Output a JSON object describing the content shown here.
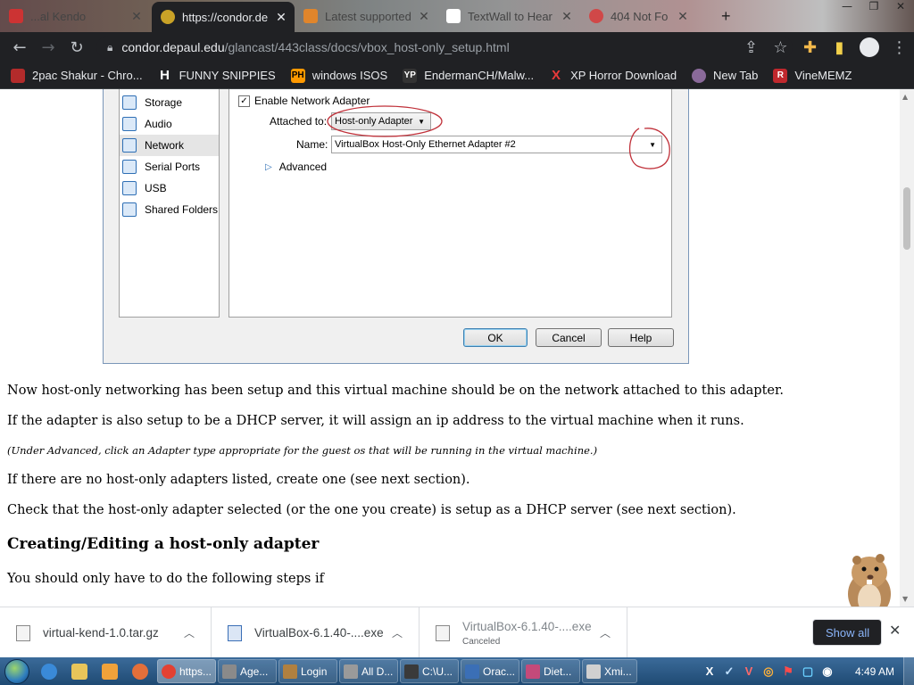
{
  "browser": {
    "tabs": [
      {
        "label": "...al Kendo",
        "icon_color": "#cc3333"
      },
      {
        "label": "https://condor.de",
        "icon_color": "#c9a227"
      },
      {
        "label": "Latest supported",
        "icon_color": "#e0852b"
      },
      {
        "label": "TextWall to Hear",
        "icon_color": "#ffffff"
      },
      {
        "label": "404 Not Fo",
        "icon_color": "#d04848"
      }
    ],
    "window_controls": [
      "—",
      "❐",
      "✕"
    ],
    "url_host": "condor.depaul.edu",
    "url_path": "/glancast/443class/docs/vbox_host-only_setup.html",
    "bookmarks": [
      {
        "label": "2pac Shakur - Chro...",
        "icon": "",
        "icon_color": "#b32b2b"
      },
      {
        "label": "FUNNY SNIPPIES",
        "icon": "H",
        "icon_color": "#202124"
      },
      {
        "label": "windows ISOS",
        "icon": "PH",
        "icon_color": "#ff9900"
      },
      {
        "label": "EndermanCH/Malw...",
        "icon": "YP",
        "icon_color": "#333333"
      },
      {
        "label": "XP Horror Download",
        "icon": "X",
        "icon_color": "#202124"
      },
      {
        "label": "New Tab",
        "icon": "",
        "icon_color": "#8a6a9a"
      },
      {
        "label": "VineMEMZ",
        "icon": "R",
        "icon_color": "#c0282d"
      }
    ]
  },
  "dialog": {
    "categories": [
      {
        "label": "Storage",
        "selected": false
      },
      {
        "label": "Audio",
        "selected": false
      },
      {
        "label": "Network",
        "selected": true
      },
      {
        "label": "Serial Ports",
        "selected": false
      },
      {
        "label": "USB",
        "selected": false
      },
      {
        "label": "Shared Folders",
        "selected": false
      }
    ],
    "enable_label": "Enable Network Adapter",
    "enable_checked": "✓",
    "attached_label": "Attached to:",
    "attached_value": "Host-only Adapter",
    "name_label": "Name:",
    "name_value": "VirtualBox Host-Only Ethernet Adapter #2",
    "advanced_label": "Advanced",
    "ok_label": "OK",
    "cancel_label": "Cancel",
    "help_label": "Help"
  },
  "article": {
    "p1": "Now host-only networking has been setup and this virtual machine should be on the network attached to this adapter.",
    "p2": "If the adapter is also setup to be a DHCP server, it will assign an ip address to the virtual machine when it runs.",
    "note": "(Under Advanced, click an Adapter type appropriate for the guest os that will be running in the virtual machine.)",
    "p3": "If there are no host-only adapters listed, create one (see next section).",
    "p4": "Check that the host-only adapter selected (or the one you create) is setup as a DHCP server (see next section).",
    "heading": "Creating/Editing a host-only adapter",
    "p5": "You should only have to do the following steps if"
  },
  "downloads": {
    "items": [
      {
        "name": "virtual-kend-1.0.tar.gz",
        "sub": ""
      },
      {
        "name": "VirtualBox-6.1.40-....exe",
        "sub": ""
      },
      {
        "name": "VirtualBox-6.1.40-....exe",
        "sub": "Canceled"
      }
    ],
    "show_all": "Show all"
  },
  "taskbar": {
    "items": [
      {
        "label": "https...",
        "color": "#e34133",
        "active": true
      },
      {
        "label": "Age...",
        "color": "#8a8a8a",
        "active": false
      },
      {
        "label": "Login",
        "color": "#b08040",
        "active": false
      },
      {
        "label": "All D...",
        "color": "#9a9a9a",
        "active": false
      },
      {
        "label": "C:\\U...",
        "color": "#3a3a3a",
        "active": false
      },
      {
        "label": "Orac...",
        "color": "#3b6fb6",
        "active": false
      },
      {
        "label": "Diet...",
        "color": "#c44a7a",
        "active": false
      },
      {
        "label": "Xmi...",
        "color": "#d0d0d0",
        "active": false
      }
    ],
    "tray_icons": [
      "X",
      "✓",
      "V",
      "◎",
      "⚑",
      "▢",
      "◉"
    ],
    "clock": "4:49 AM"
  }
}
